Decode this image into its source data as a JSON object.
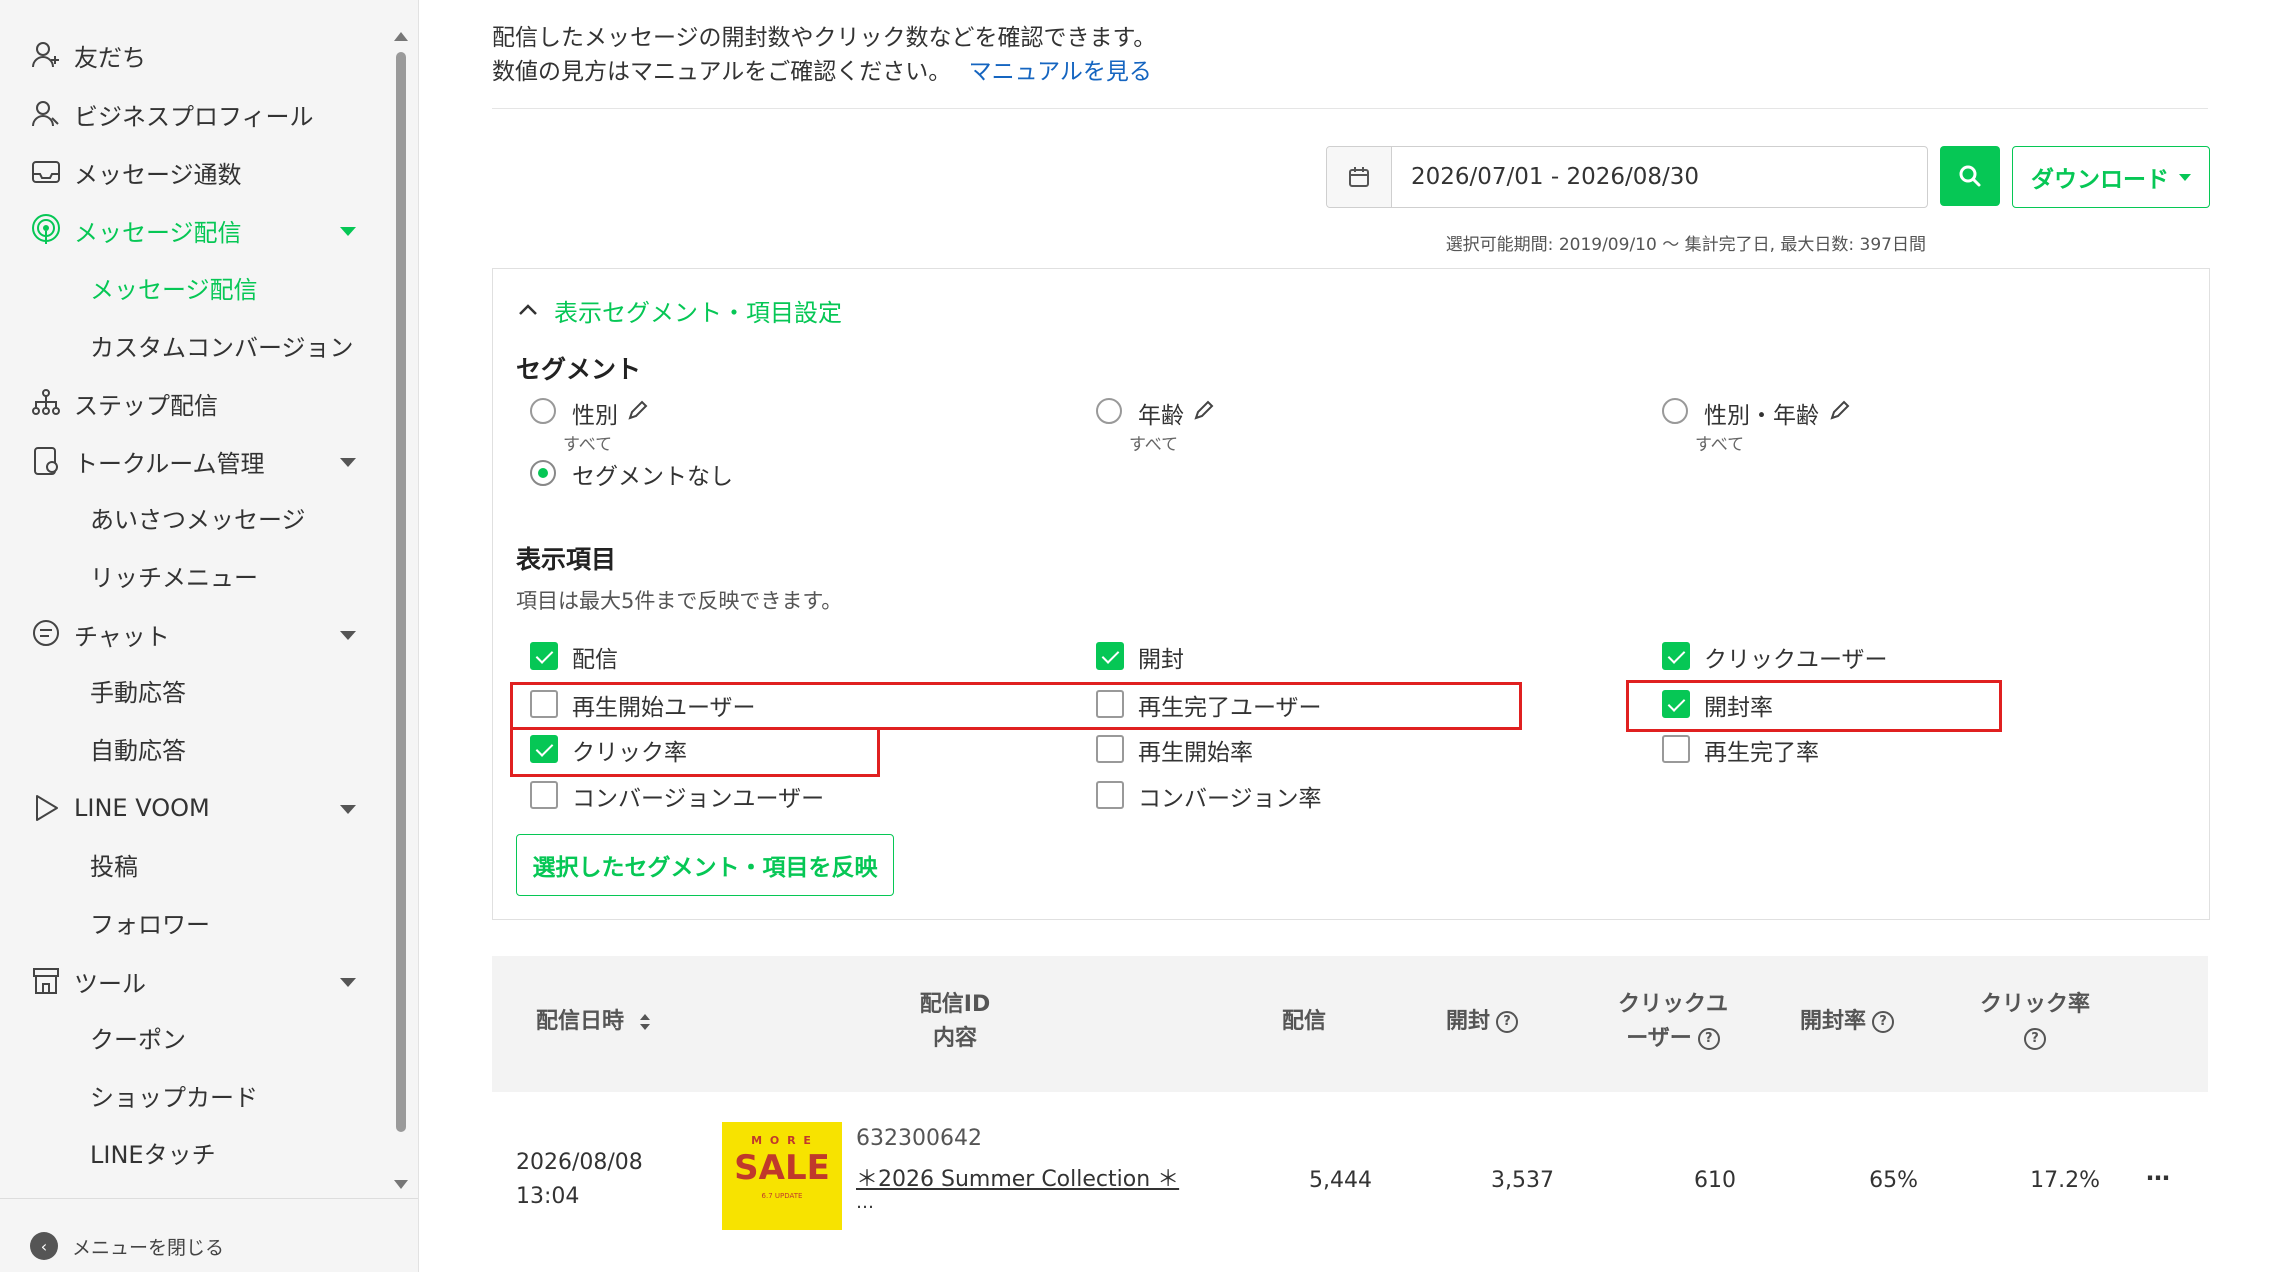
{
  "sidebar": {
    "items": [
      {
        "label": "友だち",
        "icon": "person-add-icon"
      },
      {
        "label": "ビジネスプロフィール",
        "icon": "profile-icon"
      },
      {
        "label": "メッセージ通数",
        "icon": "inbox-icon"
      },
      {
        "label": "メッセージ配信",
        "icon": "broadcast-icon",
        "active": true
      },
      {
        "label": "メッセージ配信",
        "sub": true,
        "active": true
      },
      {
        "label": "カスタムコンバージョン",
        "sub": true
      },
      {
        "label": "ステップ配信",
        "icon": "step-icon"
      },
      {
        "label": "トークルーム管理",
        "icon": "room-icon"
      },
      {
        "label": "あいさつメッセージ",
        "sub": true
      },
      {
        "label": "リッチメニュー",
        "sub": true
      },
      {
        "label": "チャット",
        "icon": "chat-icon"
      },
      {
        "label": "手動応答",
        "sub": true
      },
      {
        "label": "自動応答",
        "sub": true
      },
      {
        "label": "LINE VOOM",
        "icon": "play-icon"
      },
      {
        "label": "投稿",
        "sub": true
      },
      {
        "label": "フォロワー",
        "sub": true
      },
      {
        "label": "ツール",
        "icon": "store-icon"
      },
      {
        "label": "クーポン",
        "sub": true
      },
      {
        "label": "ショップカード",
        "sub": true
      },
      {
        "label": "LINEタッチ",
        "sub": true
      }
    ],
    "close_label": "メニューを閉じる"
  },
  "header": {
    "desc1": "配信したメッセージの開封数やクリック数などを確認できます。",
    "desc2": "数値の見方はマニュアルをご確認ください。",
    "manual_link": "マニュアルを見る"
  },
  "filters": {
    "date_range": "2026/07/01 - 2026/08/30",
    "download_label": "ダウンロード",
    "range_note": "選択可能期間: 2019/09/10 ～ 集計完了日, 最大日数: 397日間"
  },
  "settings": {
    "toggle_label": "表示セグメント・項目設定",
    "segment_title": "セグメント",
    "segments": [
      {
        "label": "性別",
        "sub": "すべて",
        "selected": false
      },
      {
        "label": "年齢",
        "sub": "すべて",
        "selected": false
      },
      {
        "label": "性別・年齢",
        "sub": "すべて",
        "selected": false
      },
      {
        "label": "セグメントなし",
        "selected": true
      }
    ],
    "items_title": "表示項目",
    "items_note": "項目は最大5件まで反映できます。",
    "items": [
      {
        "label": "配信",
        "checked": true
      },
      {
        "label": "開封",
        "checked": true
      },
      {
        "label": "クリックユーザー",
        "checked": true
      },
      {
        "label": "再生開始ユーザー",
        "checked": false
      },
      {
        "label": "再生完了ユーザー",
        "checked": false
      },
      {
        "label": "開封率",
        "checked": true
      },
      {
        "label": "クリック率",
        "checked": true
      },
      {
        "label": "再生開始率",
        "checked": false
      },
      {
        "label": "再生完了率",
        "checked": false
      },
      {
        "label": "コンバージョンユーザー",
        "checked": false
      },
      {
        "label": "コンバージョン率",
        "checked": false
      }
    ],
    "apply_label": "選択したセグメント・項目を反映"
  },
  "table": {
    "headers": {
      "date": "配信日時",
      "id_line1": "配信ID",
      "id_line2": "内容",
      "delivered": "配信",
      "opened": "開封",
      "click_users_line1": "クリックユ",
      "click_users_line2": "ーザー",
      "open_rate": "開封率",
      "click_rate": "クリック率"
    },
    "rows": [
      {
        "date": "2026/08/08",
        "time": "13:04",
        "thumb_top": "M O R E",
        "thumb_main": "SALE",
        "thumb_bottom": "6.7 UPDATE",
        "id": "632300642",
        "title": "＊2026 Summer Collection ＊",
        "ellipsis": "…",
        "delivered": "5,444",
        "opened": "3,537",
        "click_users": "610",
        "open_rate": "65%",
        "click_rate": "17.2%",
        "more": "⋯"
      }
    ]
  },
  "colors": {
    "accent": "#06c755",
    "highlight": "#e02020",
    "link": "#1565c0"
  }
}
